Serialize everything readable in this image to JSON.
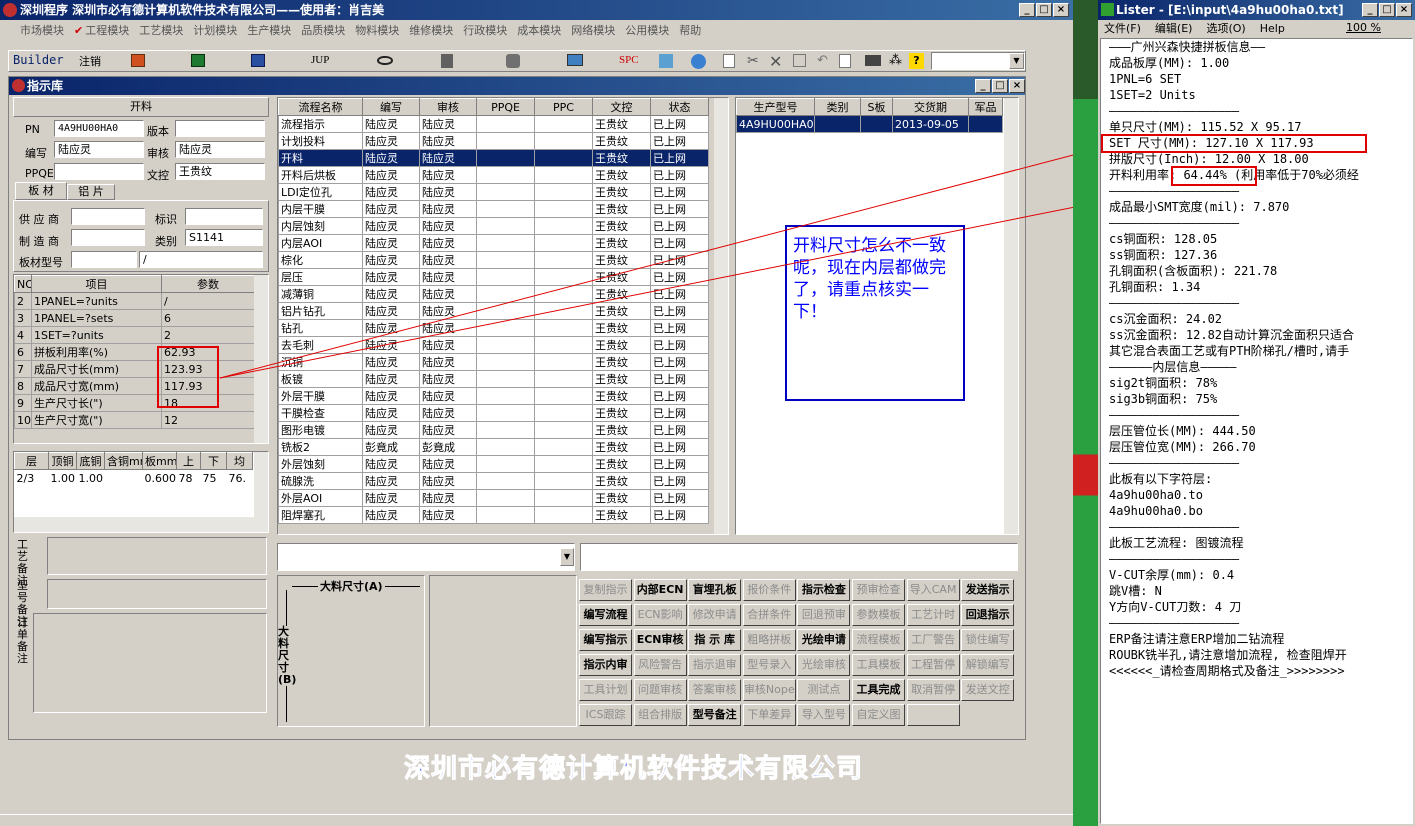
{
  "main_title": "深圳程序   深圳市必有德计算机软件技术有限公司——使用者：肖吉美",
  "menu": [
    "市场模块",
    "工程模块",
    "工艺模块",
    "计划模块",
    "生产模块",
    "品质模块",
    "物料模块",
    "维修模块",
    "行政模块",
    "成本模块",
    "网络模块",
    "公用模块",
    "帮助"
  ],
  "toolbar": {
    "builder": "Builder",
    "logout": "注销",
    "jup": "JUP",
    "spc": "SPC"
  },
  "sub_title": "指示库",
  "form": {
    "header": "开料",
    "pn_label": "PN",
    "pn": "4A9HU00HA0",
    "version_label": "版本",
    "version": "",
    "author_label": "编写",
    "author": "陆应灵",
    "review_label": "审核",
    "review": "陆应灵",
    "ppqe_label": "PPQE",
    "ppqe": "",
    "doc_label": "文控",
    "doc": "王贵纹",
    "tab1": "板 材",
    "tab2": "铝 片",
    "supplier_label": "供 应 商",
    "mark_label": "标识",
    "maker_label": "制 造 商",
    "type_label": "类别",
    "type": "S1141",
    "model_label": "板材型号",
    "model2": "/"
  },
  "params": {
    "headers": [
      "NO",
      "项目",
      "参数"
    ],
    "rows": [
      [
        "2",
        "1PANEL=?units",
        "/"
      ],
      [
        "3",
        "1PANEL=?sets",
        "6"
      ],
      [
        "4",
        "1SET=?units",
        "2"
      ],
      [
        "6",
        "拼板利用率(%)",
        "62.93"
      ],
      [
        "7",
        "成品尺寸长(mm)",
        "123.93"
      ],
      [
        "8",
        "成品尺寸宽(mm)",
        "117.93"
      ],
      [
        "9",
        "生产尺寸长(\")",
        "18"
      ],
      [
        "10",
        "生产尺寸宽(\")",
        "12"
      ]
    ]
  },
  "layers": {
    "headers": [
      "层",
      "顶铜",
      "底铜",
      "含铜mm",
      "板mm",
      "上",
      "下",
      "均"
    ],
    "row": [
      "2/3",
      "1.00",
      "1.00",
      "",
      "0.600",
      "78",
      "75",
      "76."
    ]
  },
  "notes": {
    "craft": "工艺备注",
    "model": "型号备注",
    "order": "订单备注"
  },
  "flow": {
    "headers": [
      "流程名称",
      "编写",
      "审核",
      "PPQE",
      "PPC",
      "文控",
      "状态"
    ],
    "rows": [
      [
        "流程指示",
        "陆应灵",
        "陆应灵",
        "",
        "",
        "王贵纹",
        "已上网"
      ],
      [
        "计划投料",
        "陆应灵",
        "陆应灵",
        "",
        "",
        "王贵纹",
        "已上网"
      ],
      [
        "开料",
        "陆应灵",
        "陆应灵",
        "",
        "",
        "王贵纹",
        "已上网"
      ],
      [
        "开料后烘板",
        "陆应灵",
        "陆应灵",
        "",
        "",
        "王贵纹",
        "已上网"
      ],
      [
        "LDI定位孔",
        "陆应灵",
        "陆应灵",
        "",
        "",
        "王贵纹",
        "已上网"
      ],
      [
        "内层干膜",
        "陆应灵",
        "陆应灵",
        "",
        "",
        "王贵纹",
        "已上网"
      ],
      [
        "内层蚀刻",
        "陆应灵",
        "陆应灵",
        "",
        "",
        "王贵纹",
        "已上网"
      ],
      [
        "内层AOI",
        "陆应灵",
        "陆应灵",
        "",
        "",
        "王贵纹",
        "已上网"
      ],
      [
        "棕化",
        "陆应灵",
        "陆应灵",
        "",
        "",
        "王贵纹",
        "已上网"
      ],
      [
        "层压",
        "陆应灵",
        "陆应灵",
        "",
        "",
        "王贵纹",
        "已上网"
      ],
      [
        "减薄铜",
        "陆应灵",
        "陆应灵",
        "",
        "",
        "王贵纹",
        "已上网"
      ],
      [
        "铝片钻孔",
        "陆应灵",
        "陆应灵",
        "",
        "",
        "王贵纹",
        "已上网"
      ],
      [
        "钻孔",
        "陆应灵",
        "陆应灵",
        "",
        "",
        "王贵纹",
        "已上网"
      ],
      [
        "去毛刺",
        "陆应灵",
        "陆应灵",
        "",
        "",
        "王贵纹",
        "已上网"
      ],
      [
        "沉铜",
        "陆应灵",
        "陆应灵",
        "",
        "",
        "王贵纹",
        "已上网"
      ],
      [
        "板镀",
        "陆应灵",
        "陆应灵",
        "",
        "",
        "王贵纹",
        "已上网"
      ],
      [
        "外层干膜",
        "陆应灵",
        "陆应灵",
        "",
        "",
        "王贵纹",
        "已上网"
      ],
      [
        "干膜检查",
        "陆应灵",
        "陆应灵",
        "",
        "",
        "王贵纹",
        "已上网"
      ],
      [
        "图形电镀",
        "陆应灵",
        "陆应灵",
        "",
        "",
        "王贵纹",
        "已上网"
      ],
      [
        "铣板2",
        "彭竟成",
        "彭竟成",
        "",
        "",
        "王贵纹",
        "已上网"
      ],
      [
        "外层蚀刻",
        "陆应灵",
        "陆应灵",
        "",
        "",
        "王贵纹",
        "已上网"
      ],
      [
        "硫腺洗",
        "陆应灵",
        "陆应灵",
        "",
        "",
        "王贵纹",
        "已上网"
      ],
      [
        "外层AOI",
        "陆应灵",
        "陆应灵",
        "",
        "",
        "王贵纹",
        "已上网"
      ],
      [
        "阻焊塞孔",
        "陆应灵",
        "陆应灵",
        "",
        "",
        "王贵纹",
        "已上网"
      ]
    ]
  },
  "orders": {
    "headers": [
      "生产型号",
      "类别",
      "S板",
      "交货期",
      "军品"
    ],
    "row": [
      "4A9HU00HA0",
      "",
      "",
      "2013-09-05",
      ""
    ]
  },
  "annotation": "开料尺寸怎么不一致呢，现在内层都做完了，请重点核实一下！",
  "dim": {
    "a": "大料尺寸(A)",
    "b": "大料尺寸(B)"
  },
  "buttons": [
    [
      "复制指示",
      "内部ECN",
      "盲埋孔板",
      "报价条件",
      "指示检查",
      "预审检查",
      "导入CAM",
      "发送指示"
    ],
    [
      "编写流程",
      "ECN影响",
      "修改申请",
      "合拼条件",
      "回退预审",
      "参数模板",
      "工艺计时",
      "回退指示"
    ],
    [
      "编写指示",
      "ECN审核",
      "指 示 库",
      "粗略拼板",
      "光绘申请",
      "流程模板",
      "工厂警告",
      "锁住编写"
    ],
    [
      "指示内审",
      "风险警告",
      "指示退审",
      "型号录入",
      "光绘审核",
      "工具模板",
      "工程暂停",
      "解锁编写"
    ],
    [
      "工具计划",
      "问题审核",
      "答案审核",
      "审核Nope",
      "测试点",
      "工具完成",
      "取消暂停",
      "发送文控"
    ],
    [
      "ICS跟踪",
      "组合排版",
      "型号备注",
      "下单差异",
      "导入型号",
      "自定义图",
      ""
    ]
  ],
  "company": "深圳市必有德计算机软件技术有限公司",
  "lister": {
    "title": "Lister - [E:\\input\\4a9hu00ha0.txt]",
    "menu": [
      "文件(F)",
      "编辑(E)",
      "选项(O)",
      "Help"
    ],
    "zoom": "100 %",
    "lines": [
      "———广州兴森快捷拼板信息——",
      "成品板厚(MM): 1.00",
      "1PNL=6 SET",
      "1SET=2 Units",
      "——————————————————",
      "单只尺寸(MM): 115.52 X 95.17",
      "SET 尺寸(MM): 127.10 X 117.93",
      "拼版尺寸(Inch): 12.00 X 18.00",
      "开料利用率: 64.44% (利用率低于70%必须经",
      "——————————————————",
      "成品最小SMT宽度(mil): 7.870",
      "——————————————————",
      "cs铜面积: 128.05",
      "ss铜面积: 127.36",
      "孔铜面积(含板面积): 221.78",
      "孔铜面积: 1.34",
      "——————————————————",
      "cs沉金面积: 24.02",
      "ss沉金面积: 12.82自动计算沉金面积只适合",
      "其它混合表面工艺或有PTH阶梯孔/槽时,请手",
      "——————内层信息—————",
      "sig2t铜面积: 78%",
      "sig3b铜面积: 75%",
      "——————————————————",
      "层压管位长(MM): 444.50",
      "层压管位宽(MM): 266.70",
      "——————————————————",
      "此板有以下字符层:",
      "4a9hu00ha0.to",
      "4a9hu00ha0.bo",
      "——————————————————",
      "此板工艺流程: 图镀流程",
      "——————————————————",
      "V-CUT余厚(mm): 0.4",
      "跳V槽: N",
      "Y方向V-CUT刀数: 4 刀",
      "——————————————————",
      "ERP备注请注意ERP增加二钻流程",
      "ROUBK铣半孔,请注意增加流程, 检查阻焊开",
      "<<<<<<_请检查周期格式及备注_>>>>>>>>"
    ]
  }
}
